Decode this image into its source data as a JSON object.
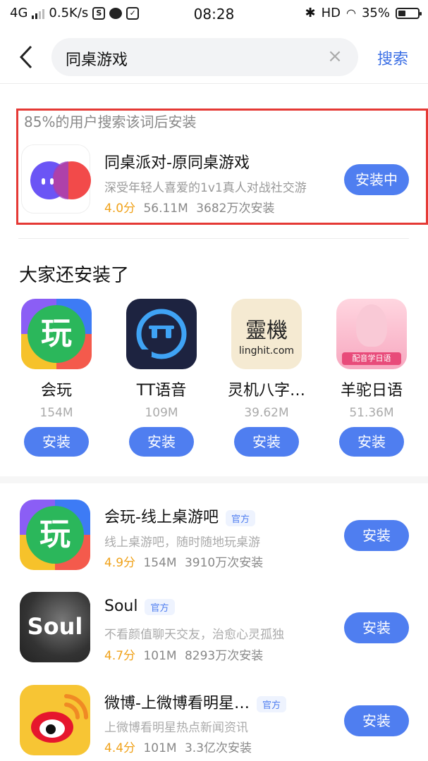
{
  "status_bar": {
    "network": "4G",
    "speed": "0.5K/s",
    "time": "08:28",
    "hd": "HD",
    "battery": "35%"
  },
  "search": {
    "query": "同桌游戏",
    "button": "搜索"
  },
  "top_result": {
    "hint": "85%的用户搜索该词后安装",
    "name": "同桌派对-原同桌游戏",
    "desc": "深受年轻人喜爱的1v1真人对战社交游",
    "rating": "4.0分",
    "size": "56.11M",
    "installs": "3682万次安装",
    "button": "安装中"
  },
  "also_installed": {
    "title": "大家还安装了",
    "items": [
      {
        "name": "会玩",
        "size": "154M",
        "button": "安装",
        "icon": "huiwan-icon",
        "glyph": "玩"
      },
      {
        "name": "TT语音",
        "size": "109M",
        "button": "安装",
        "icon": "tt-voice-icon"
      },
      {
        "name": "灵机八字…",
        "size": "39.62M",
        "button": "安装",
        "icon": "linghit-icon",
        "glyph_top": "靈機",
        "glyph_bottom": "linghit.com"
      },
      {
        "name": "羊驼日语",
        "size": "51.36M",
        "button": "安装",
        "icon": "yangtuo-icon",
        "glyph": "配音学日语"
      }
    ]
  },
  "list": [
    {
      "name": "会玩-线上桌游吧",
      "badge": "官方",
      "desc": "线上桌游吧，随时随地玩桌游",
      "rating": "4.9分",
      "size": "154M",
      "installs": "3910万次安装",
      "button": "安装",
      "glyph": "玩"
    },
    {
      "name": "Soul",
      "badge": "官方",
      "desc": "不看颜值聊天交友，治愈心灵孤独",
      "rating": "4.7分",
      "size": "101M",
      "installs": "8293万次安装",
      "button": "安装",
      "glyph": "Soul"
    },
    {
      "name": "微博-上微博看明星…",
      "badge": "官方",
      "desc": "上微博看明星热点新闻资讯",
      "rating": "4.4分",
      "size": "101M",
      "installs": "3.3亿次安装",
      "button": "安装"
    }
  ],
  "colors": {
    "accent": "#4f7ef0",
    "rating": "#f0a21a",
    "highlight_border": "#e53935"
  }
}
